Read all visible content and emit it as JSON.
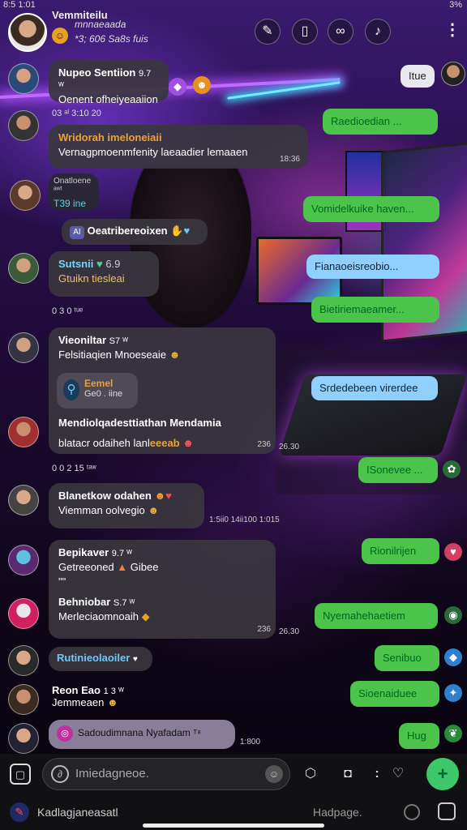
{
  "status": {
    "time": "8:5 1:01",
    "battery": "3%"
  },
  "header": {
    "title": "Vemmiteilu",
    "subtitle": "mnnaeaada",
    "subtitle2": "*3; 606 Sa8s fuis",
    "buttons": [
      "edit-icon",
      "phone-icon",
      "link-icon",
      "mic-icon"
    ]
  },
  "messages": {
    "m1": {
      "name": "Nupeo Sentiion",
      "badge": "9.7 ᵂ",
      "text": "Oenent ofheiyeaaiion"
    },
    "sys1": "03 ᵃˡ 3:10 20",
    "m2": {
      "name": "Wridorah imeloneiaii",
      "text": "Vernagpmoenmfenity laeaadier lemaaen",
      "time": "18:36"
    },
    "m3": {
      "name": "Onatloene ᵃʷᵗ",
      "text": "T39 ine"
    },
    "m4": {
      "text": "Oeatribereoixen"
    },
    "m5": {
      "name": "Sutsnii",
      "badge": "6.9",
      "text": "Gtuikn tiesleai"
    },
    "sys2": "0 3 0 ᵗᵘᵉ",
    "m6": {
      "name": "Vieoniltar",
      "badge": "S7 ᵂ",
      "text": "Felsitiaqien Mnoeseaie",
      "quote_name": "Eemel",
      "quote_sub": "Ge0 . iine",
      "name2": "Mendiolqadesttiathan Mendamia",
      "text2_a": "blatacr odaiheh lanl",
      "text2_b": "eeeab",
      "time": "236",
      "time2": "26.30"
    },
    "sys3": "0 0 2 15 ᵗᵃʷ",
    "m7": {
      "name": "Blanetkow odahen",
      "text": "Viemman oolvegio",
      "time": "1:5ii0  14ii100  1:015"
    },
    "m8": {
      "name": "Bepikaver",
      "badge": "9.7 ᵂ",
      "text": "Getreeoned",
      "text_b": "Gibee",
      "text2": "\"\""
    },
    "m9": {
      "name": "Behniobar",
      "badge": "S.7 ᵂ",
      "text": "Merleciaomnoaih",
      "time": "236",
      "time2": "26.30"
    },
    "m10": {
      "text": "Rutinieolaoiler"
    },
    "m11": {
      "name": "Reon Eao",
      "badge": "1 3 ᵂ",
      "text": "Jemmeaen"
    },
    "m12": {
      "text": "Sadoudimnana Nyafadam",
      "badge": "ᵀ⁸"
    },
    "m12_time": "1:800"
  },
  "outgoing": {
    "o1": "Itue",
    "o2": "Raedioedian ...",
    "o3": "Vomidelkuike haven...",
    "o4": "Fianaoeisreobio...",
    "o5": "Bietiriemaeamer...",
    "o6": "Srdedebeen virerdee",
    "o7": "ISonevee ...",
    "o8": "Rionilrijen",
    "o9": "Nyemahehaetiem",
    "o10": "Senibuo",
    "o11": "Sioenaiduee",
    "o12": "Hug"
  },
  "composer": {
    "placeholder": "Imiedagneoe.",
    "bottom_text": "Kadlagjaneasatl",
    "bottom_right": "Hadpage."
  },
  "colors": {
    "accent_green": "#4cc44c",
    "accent_blue": "#8fd0ff",
    "send": "#3ec86a"
  }
}
